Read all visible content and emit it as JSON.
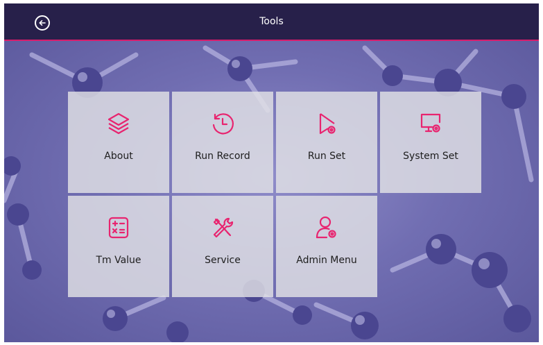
{
  "header": {
    "title": "Tools",
    "back_icon": "back-arrow-circle-icon"
  },
  "accent_color": "#e8246f",
  "tiles": [
    {
      "label": "About",
      "icon": "layers-icon"
    },
    {
      "label": "Run Record",
      "icon": "history-icon"
    },
    {
      "label": "Run Set",
      "icon": "play-settings-icon"
    },
    {
      "label": "System Set",
      "icon": "monitor-settings-icon"
    },
    {
      "label": "Tm Value",
      "icon": "calculator-icon"
    },
    {
      "label": "Service",
      "icon": "tools-icon"
    },
    {
      "label": "Admin Menu",
      "icon": "user-settings-icon"
    }
  ]
}
